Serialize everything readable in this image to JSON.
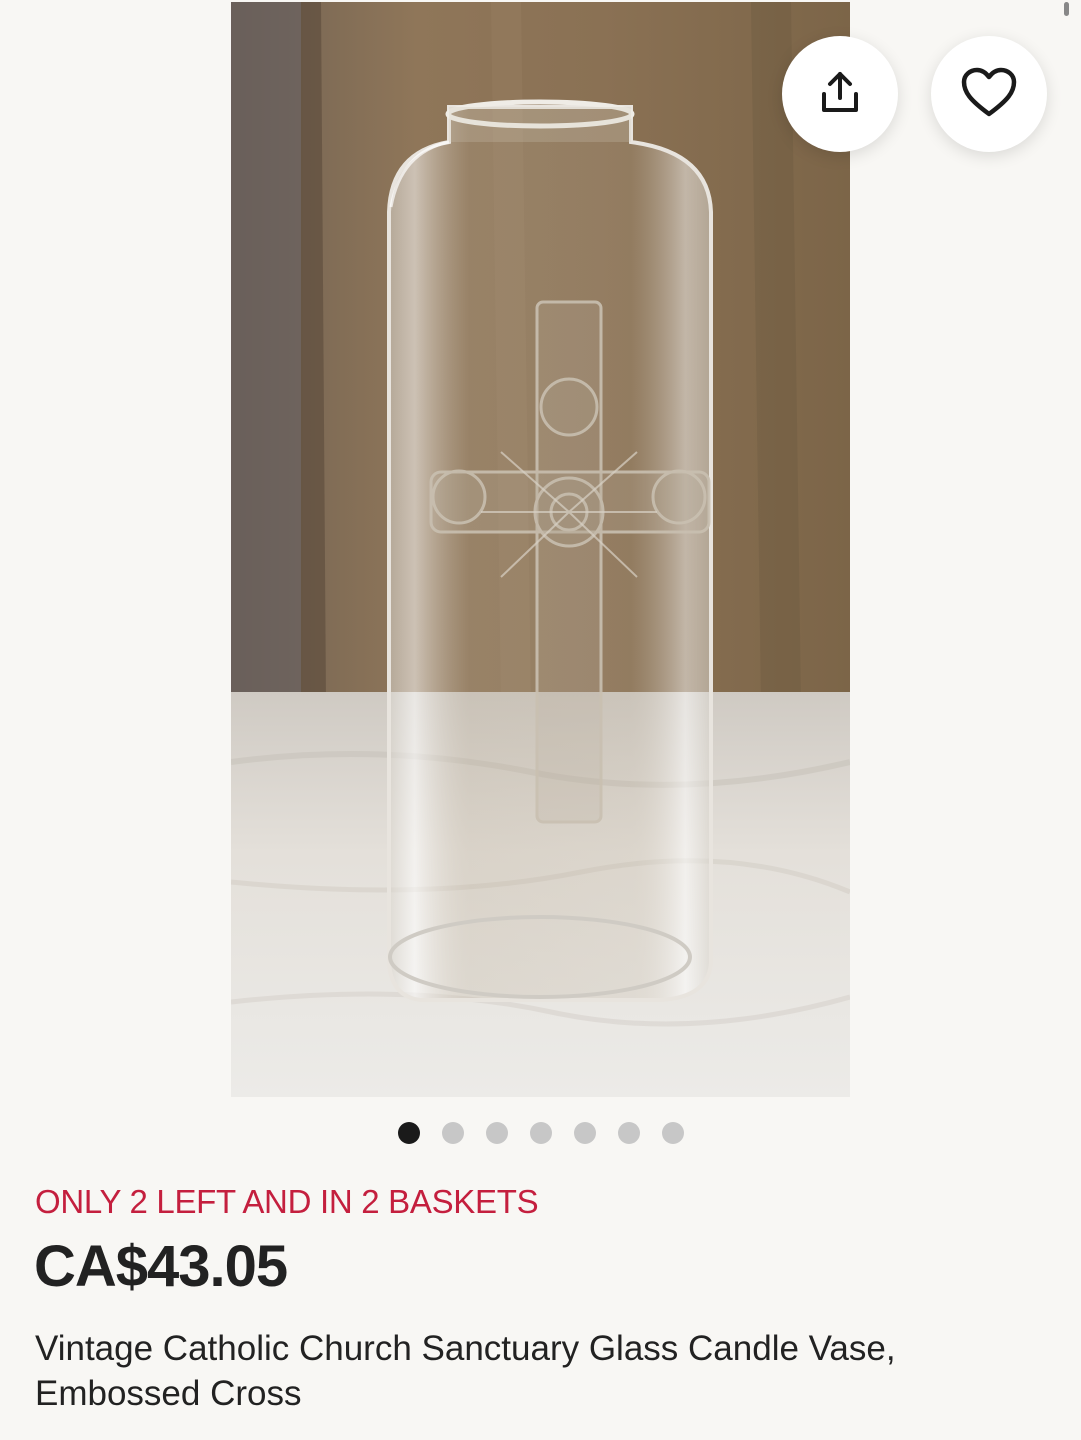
{
  "listing": {
    "stock_notice": "ONLY 2 LEFT AND IN 2 BASKETS",
    "price": "CA$43.05",
    "title": "Vintage Catholic Church Sanctuary Glass Candle Vase, Embossed Cross"
  },
  "gallery": {
    "image_count": 7,
    "active_index": 0
  },
  "actions": {
    "share_icon": "share-icon",
    "favorite_icon": "heart-icon"
  },
  "colors": {
    "stock_notice": "#c41f3e",
    "text": "#222222",
    "background": "#f8f7f4",
    "dot_active": "#1a1a1a",
    "dot_inactive": "#c7c7c7"
  }
}
